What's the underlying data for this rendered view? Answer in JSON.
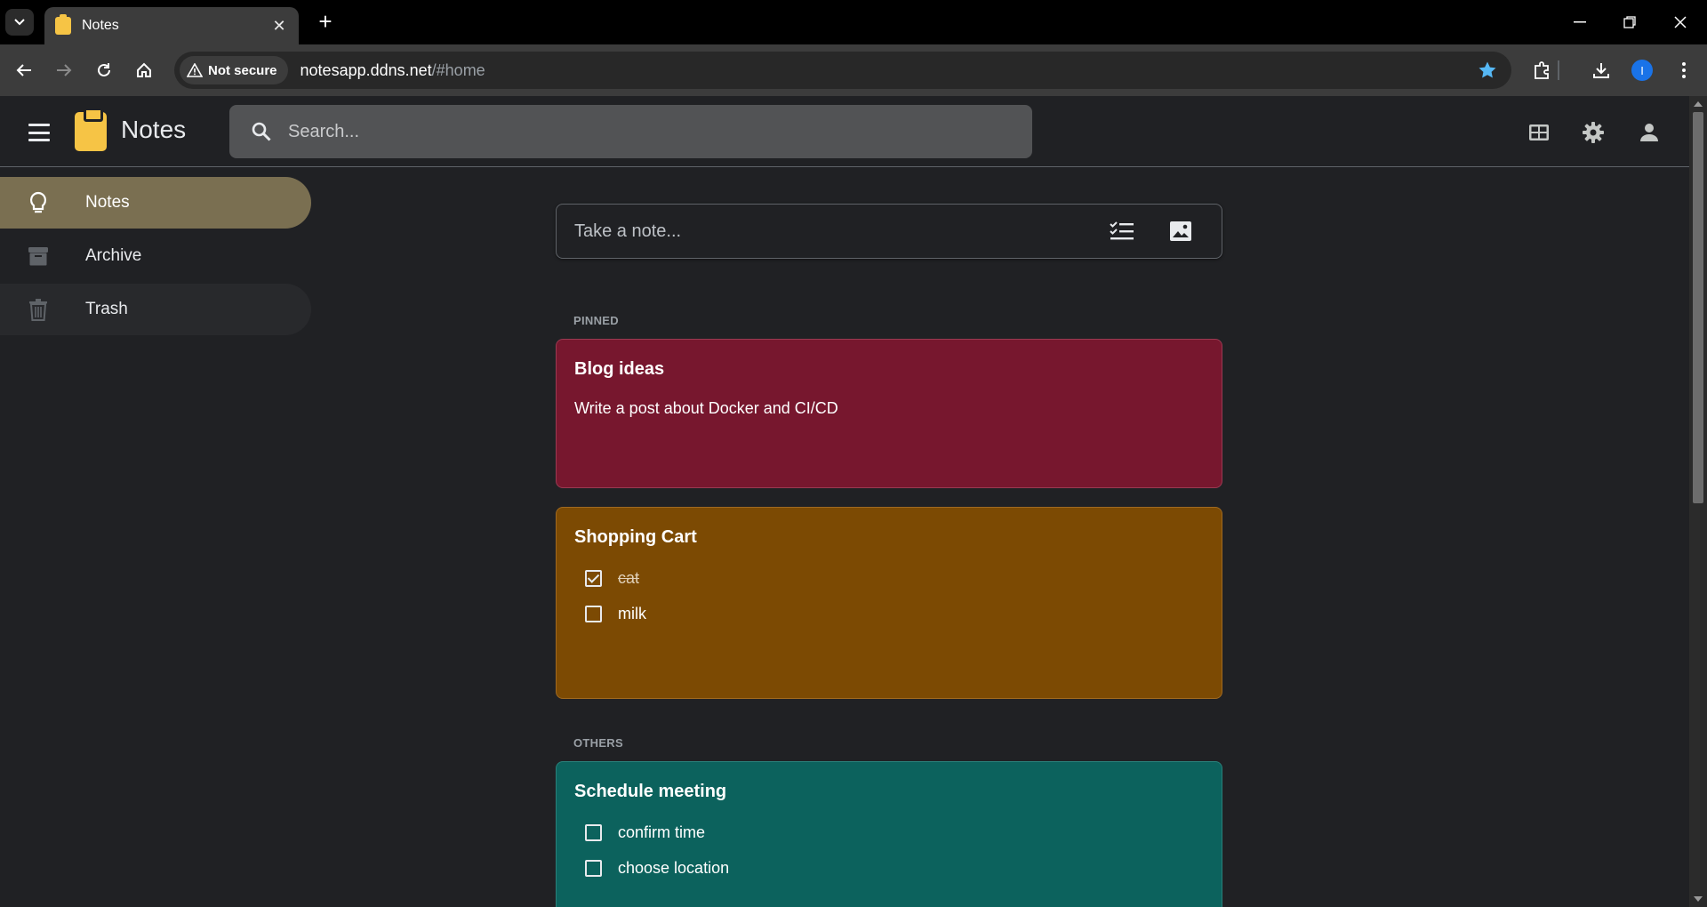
{
  "browser": {
    "tab_title": "Notes",
    "security_label": "Not secure",
    "url_host": "notesapp.ddns.net",
    "url_path": "/#home",
    "profile_initial": "I"
  },
  "app": {
    "title": "Notes",
    "search_placeholder": "Search..."
  },
  "sidebar": {
    "items": [
      {
        "label": "Notes",
        "icon": "lightbulb-icon",
        "active": true
      },
      {
        "label": "Archive",
        "icon": "archive-icon",
        "active": false
      },
      {
        "label": "Trash",
        "icon": "trash-icon",
        "active": false
      }
    ]
  },
  "composer": {
    "placeholder": "Take a note..."
  },
  "sections": {
    "pinned": "PINNED",
    "others": "OTHERS"
  },
  "notes": [
    {
      "title": "Blog ideas",
      "body": "Write a post about Docker and CI/CD",
      "color": "#77172e"
    },
    {
      "title": "Shopping Cart",
      "color": "#7c4a03",
      "items": [
        {
          "text": "cat",
          "checked": true
        },
        {
          "text": "milk",
          "checked": false
        }
      ]
    },
    {
      "title": "Schedule meeting",
      "color": "#0c625d",
      "items": [
        {
          "text": "confirm time",
          "checked": false
        },
        {
          "text": "choose location",
          "checked": false
        }
      ]
    }
  ],
  "colors": {
    "accent_active": "#7a6f51",
    "logo": "#f6c445"
  }
}
